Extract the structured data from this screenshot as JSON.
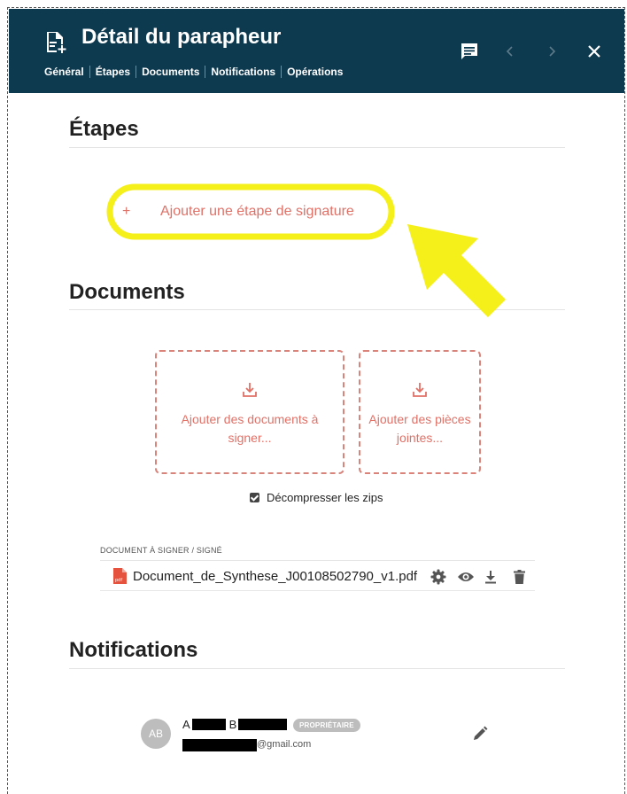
{
  "header": {
    "title": "Détail du parapheur",
    "tabs": [
      "Général",
      "Étapes",
      "Documents",
      "Notifications",
      "Opérations"
    ],
    "icons": {
      "doc": "document-add-icon",
      "comment": "comment-icon",
      "prev": "chevron-left-icon",
      "next": "chevron-right-icon",
      "close": "close-icon"
    },
    "background_color": "#0e3a50"
  },
  "steps": {
    "title": "Étapes",
    "add_plus": "+",
    "add_label": "Ajouter une étape de signature",
    "highlight_color": "#f5ef1a"
  },
  "documents": {
    "title": "Documents",
    "add_docs_label": "Ajouter des documents à signer...",
    "add_attachments_label": "Ajouter des pièces jointes...",
    "unzip_label": "Décompresser les zips",
    "unzip_checked": true,
    "list_header": "DOCUMENT À SIGNER / SIGNÉ",
    "files": [
      {
        "name": "Document_de_Synthese_J00108502790_v1.pdf",
        "icon": "pdf-icon"
      }
    ],
    "accent_color": "#e07167"
  },
  "notifications": {
    "title": "Notifications",
    "recipients": [
      {
        "avatar": "AB",
        "first_initial": "A",
        "last_initial": "B",
        "role_badge": "PROPRIÉTAIRE",
        "email_suffix": "@gmail.com"
      }
    ]
  }
}
